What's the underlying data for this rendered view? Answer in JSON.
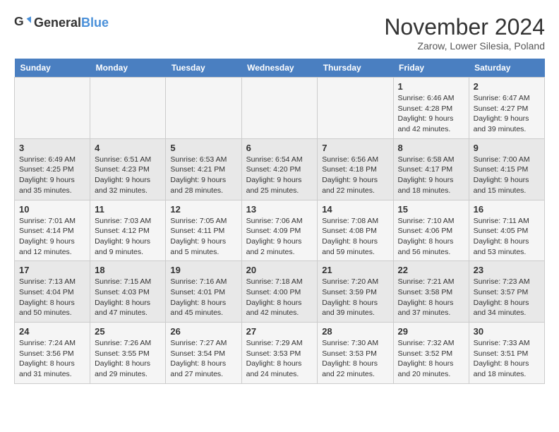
{
  "header": {
    "logo_general": "General",
    "logo_blue": "Blue",
    "month": "November 2024",
    "location": "Zarow, Lower Silesia, Poland"
  },
  "days_of_week": [
    "Sunday",
    "Monday",
    "Tuesday",
    "Wednesday",
    "Thursday",
    "Friday",
    "Saturday"
  ],
  "weeks": [
    [
      {
        "day": "",
        "info": ""
      },
      {
        "day": "",
        "info": ""
      },
      {
        "day": "",
        "info": ""
      },
      {
        "day": "",
        "info": ""
      },
      {
        "day": "",
        "info": ""
      },
      {
        "day": "1",
        "info": "Sunrise: 6:46 AM\nSunset: 4:28 PM\nDaylight: 9 hours and 42 minutes."
      },
      {
        "day": "2",
        "info": "Sunrise: 6:47 AM\nSunset: 4:27 PM\nDaylight: 9 hours and 39 minutes."
      }
    ],
    [
      {
        "day": "3",
        "info": "Sunrise: 6:49 AM\nSunset: 4:25 PM\nDaylight: 9 hours and 35 minutes."
      },
      {
        "day": "4",
        "info": "Sunrise: 6:51 AM\nSunset: 4:23 PM\nDaylight: 9 hours and 32 minutes."
      },
      {
        "day": "5",
        "info": "Sunrise: 6:53 AM\nSunset: 4:21 PM\nDaylight: 9 hours and 28 minutes."
      },
      {
        "day": "6",
        "info": "Sunrise: 6:54 AM\nSunset: 4:20 PM\nDaylight: 9 hours and 25 minutes."
      },
      {
        "day": "7",
        "info": "Sunrise: 6:56 AM\nSunset: 4:18 PM\nDaylight: 9 hours and 22 minutes."
      },
      {
        "day": "8",
        "info": "Sunrise: 6:58 AM\nSunset: 4:17 PM\nDaylight: 9 hours and 18 minutes."
      },
      {
        "day": "9",
        "info": "Sunrise: 7:00 AM\nSunset: 4:15 PM\nDaylight: 9 hours and 15 minutes."
      }
    ],
    [
      {
        "day": "10",
        "info": "Sunrise: 7:01 AM\nSunset: 4:14 PM\nDaylight: 9 hours and 12 minutes."
      },
      {
        "day": "11",
        "info": "Sunrise: 7:03 AM\nSunset: 4:12 PM\nDaylight: 9 hours and 9 minutes."
      },
      {
        "day": "12",
        "info": "Sunrise: 7:05 AM\nSunset: 4:11 PM\nDaylight: 9 hours and 5 minutes."
      },
      {
        "day": "13",
        "info": "Sunrise: 7:06 AM\nSunset: 4:09 PM\nDaylight: 9 hours and 2 minutes."
      },
      {
        "day": "14",
        "info": "Sunrise: 7:08 AM\nSunset: 4:08 PM\nDaylight: 8 hours and 59 minutes."
      },
      {
        "day": "15",
        "info": "Sunrise: 7:10 AM\nSunset: 4:06 PM\nDaylight: 8 hours and 56 minutes."
      },
      {
        "day": "16",
        "info": "Sunrise: 7:11 AM\nSunset: 4:05 PM\nDaylight: 8 hours and 53 minutes."
      }
    ],
    [
      {
        "day": "17",
        "info": "Sunrise: 7:13 AM\nSunset: 4:04 PM\nDaylight: 8 hours and 50 minutes."
      },
      {
        "day": "18",
        "info": "Sunrise: 7:15 AM\nSunset: 4:03 PM\nDaylight: 8 hours and 47 minutes."
      },
      {
        "day": "19",
        "info": "Sunrise: 7:16 AM\nSunset: 4:01 PM\nDaylight: 8 hours and 45 minutes."
      },
      {
        "day": "20",
        "info": "Sunrise: 7:18 AM\nSunset: 4:00 PM\nDaylight: 8 hours and 42 minutes."
      },
      {
        "day": "21",
        "info": "Sunrise: 7:20 AM\nSunset: 3:59 PM\nDaylight: 8 hours and 39 minutes."
      },
      {
        "day": "22",
        "info": "Sunrise: 7:21 AM\nSunset: 3:58 PM\nDaylight: 8 hours and 37 minutes."
      },
      {
        "day": "23",
        "info": "Sunrise: 7:23 AM\nSunset: 3:57 PM\nDaylight: 8 hours and 34 minutes."
      }
    ],
    [
      {
        "day": "24",
        "info": "Sunrise: 7:24 AM\nSunset: 3:56 PM\nDaylight: 8 hours and 31 minutes."
      },
      {
        "day": "25",
        "info": "Sunrise: 7:26 AM\nSunset: 3:55 PM\nDaylight: 8 hours and 29 minutes."
      },
      {
        "day": "26",
        "info": "Sunrise: 7:27 AM\nSunset: 3:54 PM\nDaylight: 8 hours and 27 minutes."
      },
      {
        "day": "27",
        "info": "Sunrise: 7:29 AM\nSunset: 3:53 PM\nDaylight: 8 hours and 24 minutes."
      },
      {
        "day": "28",
        "info": "Sunrise: 7:30 AM\nSunset: 3:53 PM\nDaylight: 8 hours and 22 minutes."
      },
      {
        "day": "29",
        "info": "Sunrise: 7:32 AM\nSunset: 3:52 PM\nDaylight: 8 hours and 20 minutes."
      },
      {
        "day": "30",
        "info": "Sunrise: 7:33 AM\nSunset: 3:51 PM\nDaylight: 8 hours and 18 minutes."
      }
    ]
  ]
}
